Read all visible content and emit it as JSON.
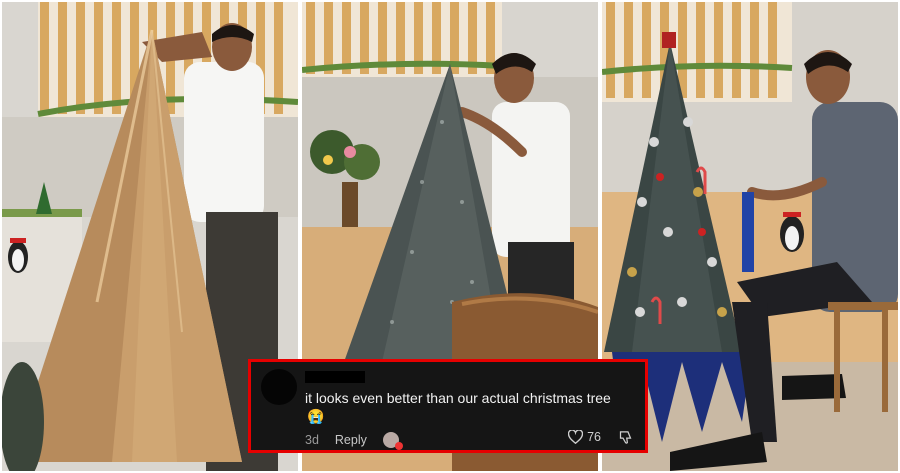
{
  "collage": {
    "panels": [
      {
        "label": "panel-cardboard-cone"
      },
      {
        "label": "panel-tinsel-tree"
      },
      {
        "label": "panel-decorated-tree"
      }
    ]
  },
  "comment": {
    "text": "it looks even better than our actual christmas tree",
    "emoji": "😭",
    "time": "3d",
    "reply_label": "Reply",
    "likes": "76",
    "border_color": "#e60000"
  }
}
